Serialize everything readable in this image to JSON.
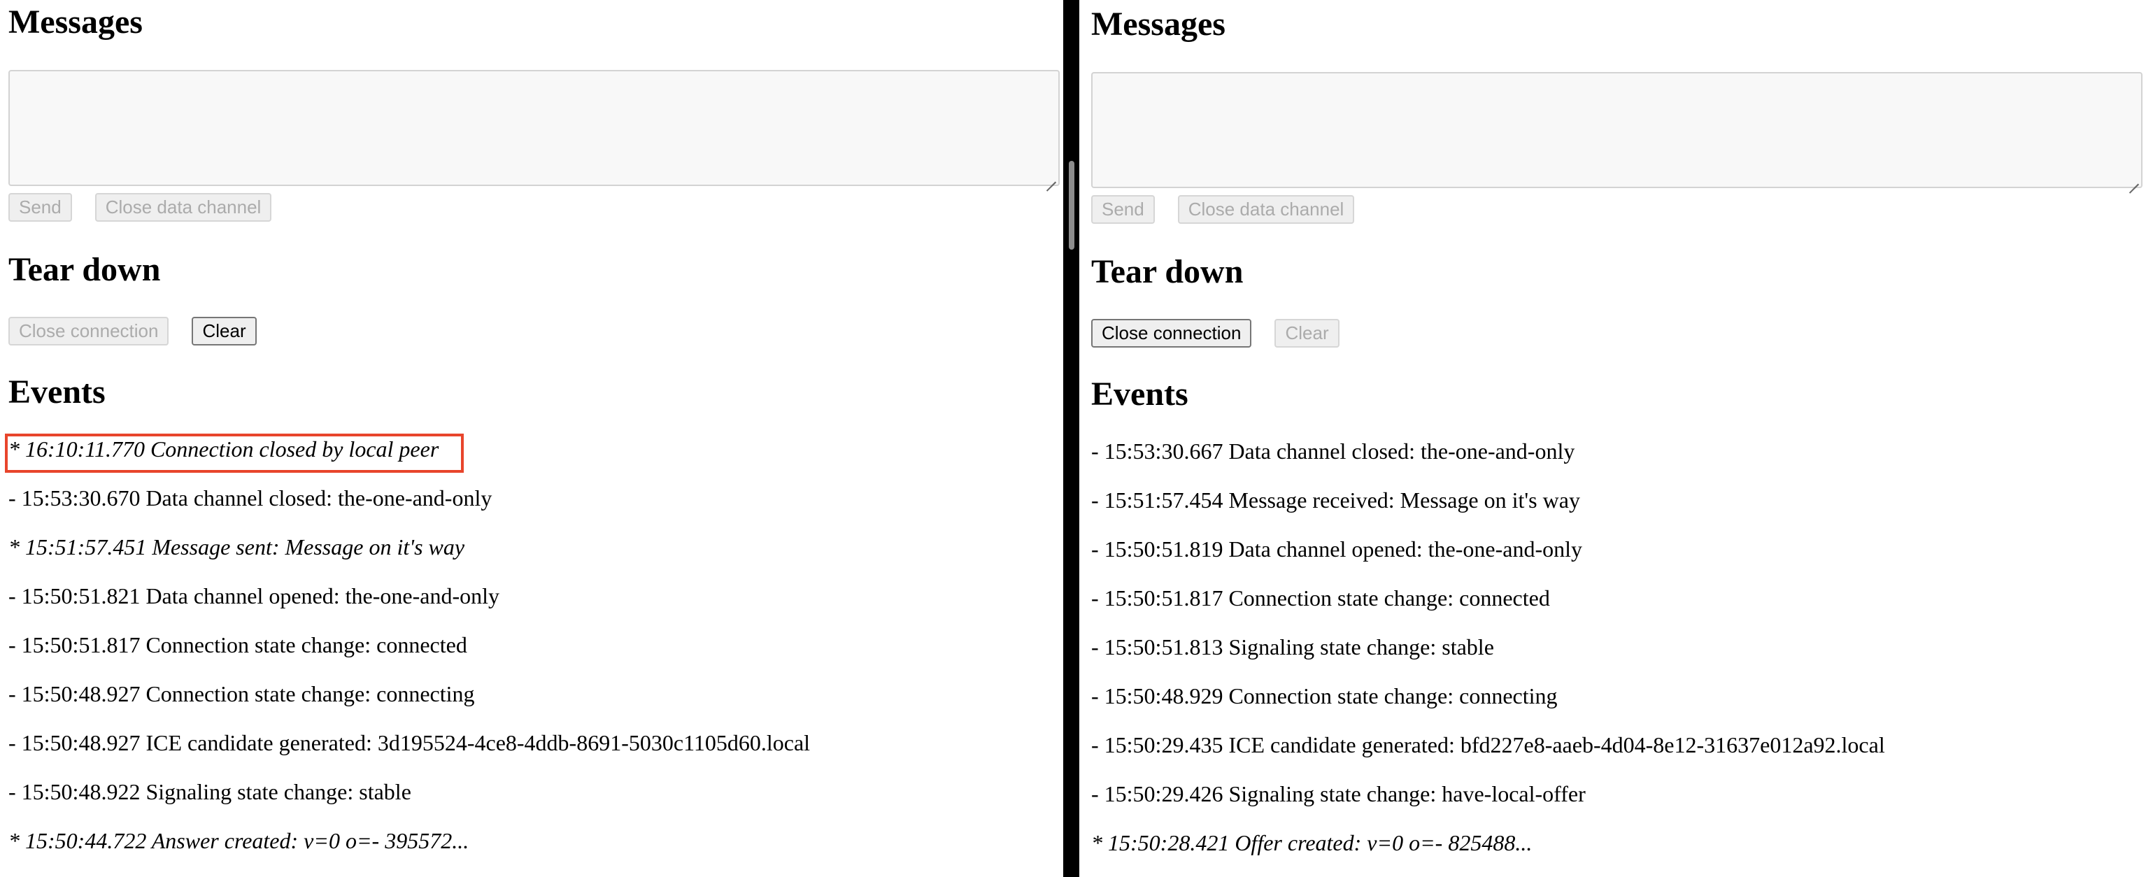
{
  "left": {
    "messages_heading": "Messages",
    "message_input": {
      "value": "",
      "placeholder": ""
    },
    "send_label": "Send",
    "send_enabled": false,
    "close_channel_label": "Close data channel",
    "close_channel_enabled": false,
    "teardown_heading": "Tear down",
    "close_connection_label": "Close connection",
    "close_connection_enabled": false,
    "clear_label": "Clear",
    "clear_enabled": true,
    "events_heading": "Events",
    "events": [
      {
        "text": "* 16:10:11.770 Connection closed by local peer",
        "italic": true,
        "highlighted": true
      },
      {
        "text": "- 15:53:30.670 Data channel closed: the-one-and-only",
        "italic": false
      },
      {
        "text": "* 15:51:57.451 Message sent: Message on it's way",
        "italic": true
      },
      {
        "text": "- 15:50:51.821 Data channel opened: the-one-and-only",
        "italic": false
      },
      {
        "text": "- 15:50:51.817 Connection state change: connected",
        "italic": false
      },
      {
        "text": "- 15:50:48.927 Connection state change: connecting",
        "italic": false
      },
      {
        "text": "- 15:50:48.927 ICE candidate generated: 3d195524-4ce8-4ddb-8691-5030c1105d60.local",
        "italic": false
      },
      {
        "text": "- 15:50:48.922 Signaling state change: stable",
        "italic": false
      },
      {
        "text": "* 15:50:44.722 Answer created: v=0 o=- 395572...",
        "italic": true
      }
    ]
  },
  "right": {
    "messages_heading": "Messages",
    "message_input": {
      "value": "",
      "placeholder": ""
    },
    "send_label": "Send",
    "send_enabled": false,
    "close_channel_label": "Close data channel",
    "close_channel_enabled": false,
    "teardown_heading": "Tear down",
    "close_connection_label": "Close connection",
    "close_connection_enabled": true,
    "clear_label": "Clear",
    "clear_enabled": false,
    "events_heading": "Events",
    "events": [
      {
        "text": "- 15:53:30.667 Data channel closed: the-one-and-only",
        "italic": false
      },
      {
        "text": "- 15:51:57.454 Message received: Message on it's way",
        "italic": false
      },
      {
        "text": "- 15:50:51.819 Data channel opened: the-one-and-only",
        "italic": false
      },
      {
        "text": "- 15:50:51.817 Connection state change: connected",
        "italic": false
      },
      {
        "text": "- 15:50:51.813 Signaling state change: stable",
        "italic": false
      },
      {
        "text": "- 15:50:48.929 Connection state change: connecting",
        "italic": false
      },
      {
        "text": "- 15:50:29.435 ICE candidate generated: bfd227e8-aaeb-4d04-8e12-31637e012a92.local",
        "italic": false
      },
      {
        "text": "- 15:50:29.426 Signaling state change: have-local-offer",
        "italic": false
      },
      {
        "text": "* 15:50:28.421 Offer created: v=0 o=- 825488...",
        "italic": true
      }
    ]
  },
  "colors": {
    "highlight_border": "#e8452c",
    "divider": "#000000",
    "disabled_text": "#ababab"
  }
}
